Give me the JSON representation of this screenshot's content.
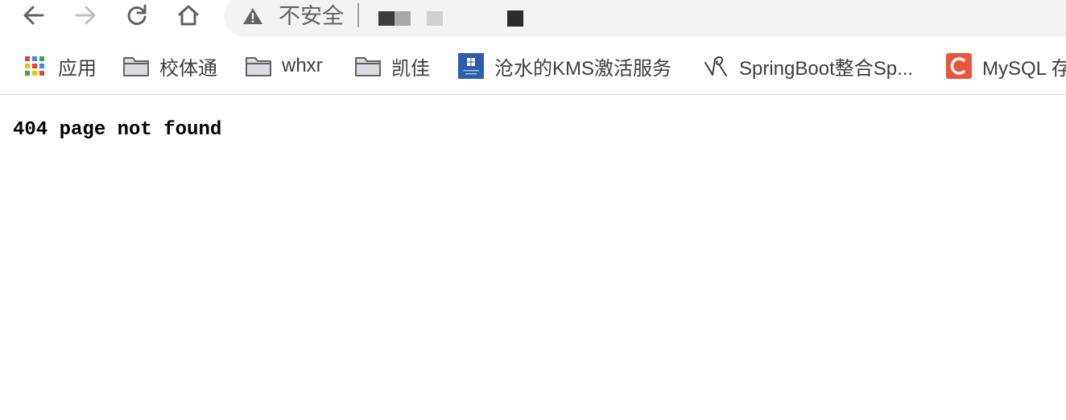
{
  "omnibox": {
    "security_label": "不安全",
    "warning_icon": "warning-icon"
  },
  "nav": {
    "back_icon": "arrow-left-icon",
    "forward_icon": "arrow-right-icon",
    "reload_icon": "reload-icon",
    "home_icon": "home-icon"
  },
  "bookmarks": [
    {
      "label": "应用",
      "icon": "apps-grid-icon"
    },
    {
      "label": "校体通",
      "icon": "folder-icon"
    },
    {
      "label": "whxr",
      "icon": "folder-icon"
    },
    {
      "label": "凯佳",
      "icon": "folder-icon"
    },
    {
      "label": "沧水的KMS激活服务",
      "icon": "windows-icon"
    },
    {
      "label": "SpringBoot整合Sp...",
      "icon": "spring-icon"
    },
    {
      "label": "MySQL 存",
      "icon": "c-logo-icon"
    }
  ],
  "page": {
    "body_text": "404 page not found"
  },
  "colors": {
    "toolbar_bg": "#ffffff",
    "omnibox_bg": "#f1f3f4",
    "icon_gray": "#5f6368",
    "text_dark": "#3c4043",
    "c_logo_red": "#e8573d",
    "windows_blue": "#2b5fad"
  }
}
